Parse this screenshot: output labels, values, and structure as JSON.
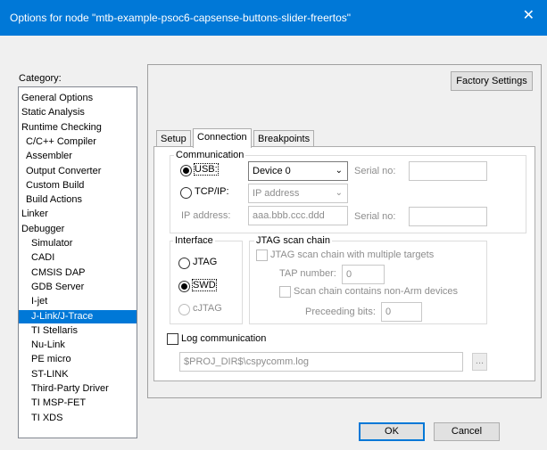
{
  "window": {
    "title": "Options for node \"mtb-example-psoc6-capsense-buttons-slider-freertos\"",
    "close_glyph": "✕"
  },
  "category": {
    "label": "Category:",
    "items": [
      "General Options",
      "Static Analysis",
      "Runtime Checking",
      "C/C++ Compiler",
      "Assembler",
      "Output Converter",
      "Custom Build",
      "Build Actions",
      "Linker",
      "Debugger",
      "Simulator",
      "CADI",
      "CMSIS DAP",
      "GDB Server",
      "I-jet",
      "J-Link/J-Trace",
      "TI Stellaris",
      "Nu-Link",
      "PE micro",
      "ST-LINK",
      "Third-Party Driver",
      "TI MSP-FET",
      "TI XDS"
    ],
    "selected": "J-Link/J-Trace"
  },
  "factory_settings_label": "Factory Settings",
  "tabs": [
    "Setup",
    "Connection",
    "Breakpoints"
  ],
  "active_tab": "Connection",
  "communication": {
    "title": "Communication",
    "usb_label": "USB:",
    "usb_device": "Device 0",
    "serial_no_label": "Serial no:",
    "tcpip_label": "TCP/IP:",
    "tcpip_value": "IP address",
    "ip_address_label": "IP address:",
    "ip_address_placeholder": "aaa.bbb.ccc.ddd",
    "selected": "USB"
  },
  "interface": {
    "title": "Interface",
    "options": [
      "JTAG",
      "SWD",
      "cJTAG"
    ],
    "selected": "SWD"
  },
  "jtag_chain": {
    "title": "JTAG scan chain",
    "multi_targets_label": "JTAG scan chain with multiple targets",
    "tap_number_label": "TAP number:",
    "tap_number_value": "0",
    "non_arm_label": "Scan chain contains non-Arm devices",
    "preceding_bits_label": "Preceeding bits:",
    "preceding_bits_value": "0"
  },
  "log": {
    "label": "Log communication",
    "path": "$PROJ_DIR$\\cspycomm.log",
    "browse_label": "..."
  },
  "ok_label": "OK",
  "cancel_label": "Cancel",
  "colors": {
    "title_bar": "#0078d7",
    "selection": "#0078d7"
  }
}
